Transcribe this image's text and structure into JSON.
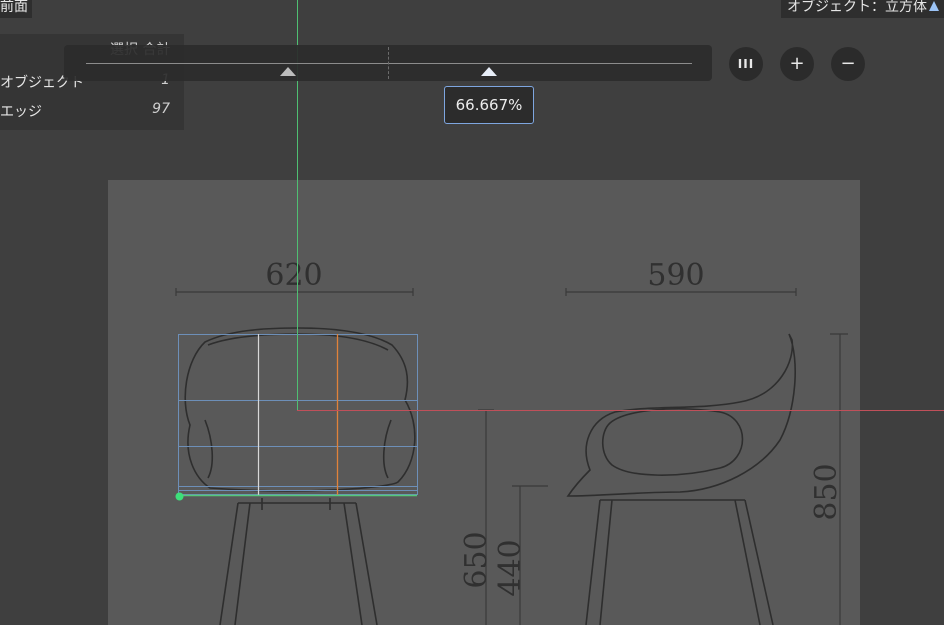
{
  "view": {
    "label": "前面"
  },
  "object": {
    "label": "オブジェクト：立方体",
    "icon": "cube-icon"
  },
  "stats": {
    "header": "選択 合計",
    "rows": [
      {
        "key": "オブジェクト",
        "value": "1"
      },
      {
        "key": "エッジ",
        "value": "97"
      }
    ]
  },
  "slider": {
    "value_label": "66.667%",
    "value_percent": 66.667,
    "buttons": [
      {
        "name": "split-button",
        "label": "III"
      },
      {
        "name": "add-cut-button",
        "label": "+"
      },
      {
        "name": "remove-cut-button",
        "label": "−"
      }
    ]
  },
  "reference": {
    "dimensions": [
      "620",
      "590",
      "650",
      "440",
      "850"
    ]
  },
  "colors": {
    "background": "#3f3f3f",
    "reference_image": "#595959",
    "y_axis": "#4fbf72",
    "x_axis": "#c0505a",
    "loop_cut": "#e0823a",
    "wire": "#6d8fb8",
    "accent": "#7ea6e0"
  }
}
